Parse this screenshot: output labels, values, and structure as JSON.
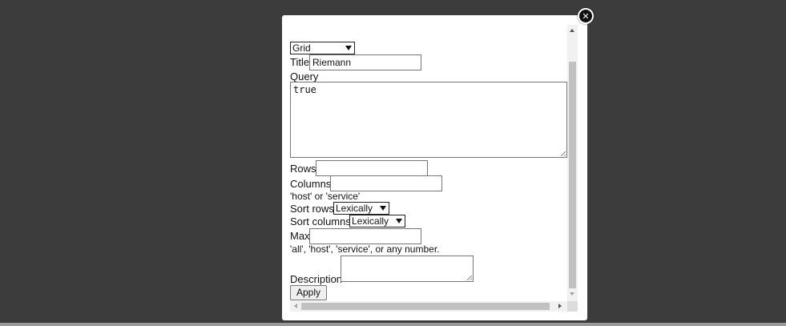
{
  "modal": {
    "view_type": {
      "selected": "Grid"
    },
    "title": {
      "label": "Title",
      "value": "Riemann"
    },
    "query": {
      "label": "Query",
      "value": "true"
    },
    "rows": {
      "label": "Rows",
      "value": ""
    },
    "columns": {
      "label": "Columns",
      "value": "",
      "hint": "'host' or 'service'"
    },
    "sort_rows": {
      "label": "Sort rows",
      "selected": "Lexically"
    },
    "sort_columns": {
      "label": "Sort columns",
      "selected": "Lexically"
    },
    "max": {
      "label": "Max",
      "value": "",
      "hint": "'all', 'host', 'service', or any number."
    },
    "description": {
      "label": "Description",
      "value": ""
    },
    "apply_label": "Apply",
    "close_icon": "close-icon"
  }
}
